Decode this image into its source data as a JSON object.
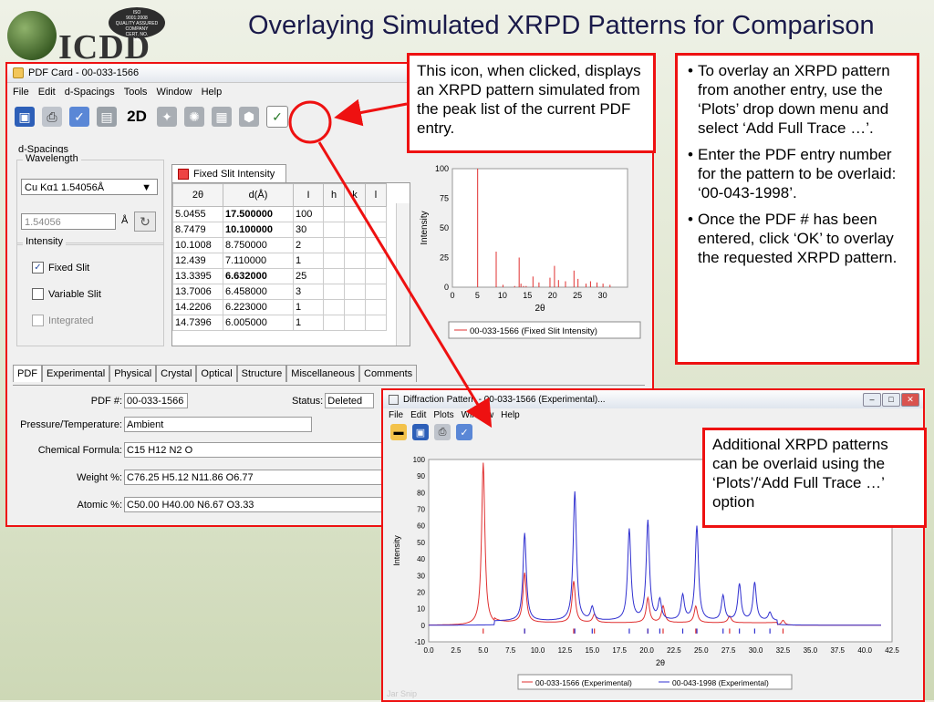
{
  "slide": {
    "title": "Overlaying Simulated XRPD Patterns for Comparison",
    "logo_text": "ICDD",
    "seal_lines": [
      "ISO",
      "9001:2008",
      "QUALITY ASSURED COMPANY",
      "CERT. NO.",
      "11408"
    ]
  },
  "pdf_card": {
    "title": "PDF Card - 00-033-1566",
    "menu": [
      "File",
      "Edit",
      "d-Spacings",
      "Tools",
      "Window",
      "Help"
    ],
    "toolbar": {
      "two_d": "2D"
    },
    "dspacings_label": "d-Spacings",
    "wavelength_label": "Wavelength",
    "wavelength_select": "Cu Kα1 1.54056Å",
    "wavelength_value": "1.54056",
    "wavelength_unit": "Å",
    "intensity_label": "Intensity",
    "opt_fixed": "Fixed Slit",
    "opt_variable": "Variable Slit",
    "opt_integrated": "Integrated",
    "table_tab": "Fixed Slit Intensity",
    "table_headers": [
      "2θ",
      "d(Å)",
      "I",
      "h",
      "k",
      "l"
    ],
    "table_rows": [
      [
        "5.0455",
        "17.500000",
        "100"
      ],
      [
        "8.7479",
        "10.100000",
        "30"
      ],
      [
        "10.1008",
        "8.750000",
        "2"
      ],
      [
        "12.439",
        "7.110000",
        "1"
      ],
      [
        "13.3395",
        "6.632000",
        "25"
      ],
      [
        "13.7006",
        "6.458000",
        "3"
      ],
      [
        "14.2206",
        "6.223000",
        "1"
      ],
      [
        "14.7396",
        "6.005000",
        "1"
      ]
    ],
    "tabs": [
      "PDF",
      "Experimental",
      "Physical",
      "Crystal",
      "Optical",
      "Structure",
      "Miscellaneous",
      "Comments"
    ],
    "pdf_num_label": "PDF #:",
    "pdf_num": "00-033-1566",
    "status_label": "Status:",
    "status": "Deleted",
    "pressure_label": "Pressure/Temperature:",
    "pressure": "Ambient",
    "formula_label": "Chemical Formula:",
    "formula": "C15 H12 N2 O",
    "weight_label": "Weight %:",
    "weight": "C76.25 H5.12 N11.86 O6.77",
    "atomic_label": "Atomic %:",
    "atomic": "C50.00 H40.00 N6.67 O3.33"
  },
  "callouts": {
    "icon_text": "This icon, when clicked, displays an XRPD pattern simulated from the peak list of the current PDF entry.",
    "steps": [
      "To overlay an XRPD pattern from another entry, use the ‘Plots’ drop down menu and select ‘Add Full Trace …’.",
      "Enter the PDF entry number for the pattern to be overlaid: ‘00-043-1998’.",
      "Once the PDF # has been entered, click ‘OK’ to overlay the requested XRPD pattern."
    ],
    "overlay_text": "Additional XRPD patterns can be overlaid using the ‘Plots’/‘Add Full Trace …’ option"
  },
  "diffraction_window": {
    "title": "Diffraction Pattern - 00-033-1566 (Experimental)...",
    "menu": [
      "File",
      "Edit",
      "Plots",
      "Window",
      "Help"
    ],
    "footer": "Jar Snip"
  },
  "colors": {
    "accent_red": "#e11111",
    "series_red": "#e03030",
    "series_blue": "#3030d0"
  },
  "chart_data": [
    {
      "type": "bar",
      "x": [
        5.0455,
        8.7479,
        10.1008,
        12.439,
        13.3395,
        13.7006,
        14.2206,
        14.7396,
        16.1,
        17.3,
        19.5,
        20.4,
        21.2,
        22.6,
        24.3,
        25.1,
        26.7,
        27.6,
        28.9,
        30.1,
        31.5
      ],
      "values": [
        100,
        30,
        2,
        1,
        25,
        3,
        1,
        1,
        9,
        4,
        8,
        18,
        6,
        5,
        14,
        7,
        3,
        5,
        4,
        3,
        2
      ],
      "xlabel": "2θ",
      "ylabel": "Intensity",
      "xlim": [
        0,
        35
      ],
      "ylim": [
        0,
        100
      ],
      "xticks": [
        0,
        5,
        10,
        15,
        20,
        25,
        30
      ],
      "yticks": [
        0,
        25,
        50,
        75,
        100
      ],
      "legend": "00-033-1566 (Fixed Slit Intensity)"
    },
    {
      "type": "line",
      "xlabel": "2θ",
      "ylabel": "Intensity",
      "xlim": [
        0,
        42.5
      ],
      "ylim": [
        -10,
        100
      ],
      "xticks": [
        "0.0",
        "2.5",
        "5.0",
        "7.5",
        "10.0",
        "12.5",
        "15.0",
        "17.5",
        "20.0",
        "22.5",
        "25.0",
        "27.5",
        "30.0",
        "32.5",
        "35.0",
        "37.5",
        "40.0",
        "42.5"
      ],
      "yticks": [
        -10,
        0,
        10,
        20,
        30,
        40,
        50,
        60,
        70,
        80,
        90,
        100
      ],
      "series": [
        {
          "name": "00-033-1566 (Experimental)",
          "color": "#e03030",
          "peaks": [
            [
              5.0,
              98
            ],
            [
              8.8,
              30
            ],
            [
              13.3,
              25
            ],
            [
              15.2,
              5
            ],
            [
              20.1,
              15
            ],
            [
              21.5,
              10
            ],
            [
              24.5,
              10
            ],
            [
              27.6,
              4
            ],
            [
              32.5,
              3
            ]
          ]
        },
        {
          "name": "00-043-1998 (Experimental)",
          "color": "#3030d0",
          "peaks": [
            [
              8.8,
              53
            ],
            [
              13.4,
              78
            ],
            [
              15.0,
              8
            ],
            [
              18.4,
              55
            ],
            [
              20.1,
              60
            ],
            [
              21.2,
              12
            ],
            [
              23.3,
              15
            ],
            [
              24.6,
              57
            ],
            [
              27.0,
              15
            ],
            [
              28.5,
              22
            ],
            [
              29.9,
              23
            ],
            [
              31.3,
              5
            ]
          ]
        }
      ]
    }
  ]
}
